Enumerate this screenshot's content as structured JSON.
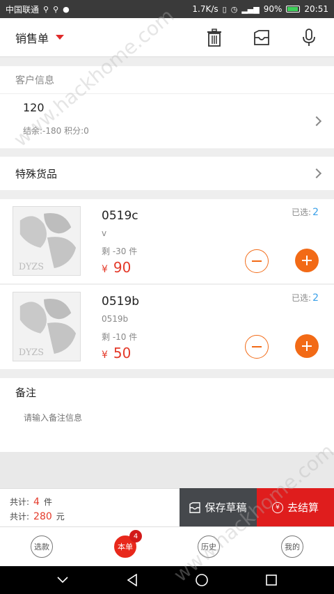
{
  "status_bar": {
    "carrier": "中国联通",
    "speed": "1.7K/s",
    "battery_pct": "90%",
    "time": "20:51"
  },
  "header": {
    "title": "销售单",
    "accent": "#e02a2a"
  },
  "customer": {
    "section_label": "客户信息",
    "id": "120",
    "meta": "结余:-180 积分:0"
  },
  "special": {
    "label": "特殊货品"
  },
  "products": [
    {
      "name": "0519c",
      "sub": "v",
      "stock": "剩 -30 件",
      "currency": "¥",
      "price": "90",
      "selected_label": "已选:",
      "selected_count": "2"
    },
    {
      "name": "0519b",
      "sub": "0519b",
      "stock": "剩 -10 件",
      "currency": "¥",
      "price": "50",
      "selected_label": "已选:",
      "selected_count": "2"
    }
  ],
  "remark": {
    "label": "备注",
    "placeholder": "请输入备注信息"
  },
  "summary": {
    "count_label": "共计:",
    "count_value": "4",
    "count_unit": "件",
    "total_label": "共计:",
    "total_value": "280",
    "total_unit": "元"
  },
  "actions": {
    "draft_label": "保存草稿",
    "checkout_label": "去结算",
    "draft_color": "#45484c",
    "checkout_color": "#df1d1d"
  },
  "tabs": [
    {
      "label": "选款"
    },
    {
      "label": "本单",
      "badge": "4"
    },
    {
      "label": "历史"
    },
    {
      "label": "我的"
    }
  ],
  "watermark": "www.hackhome.com"
}
